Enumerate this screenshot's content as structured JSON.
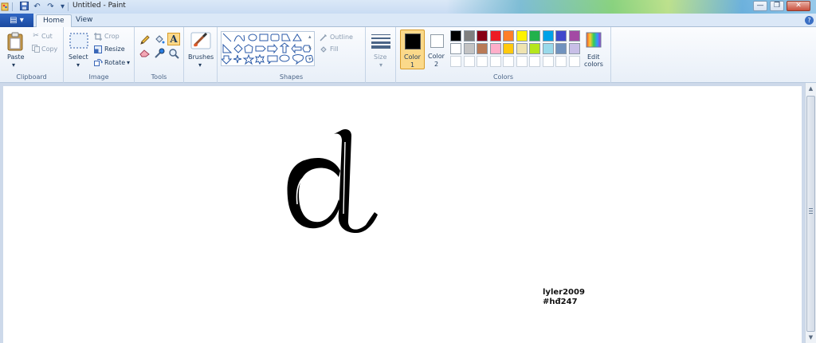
{
  "window": {
    "title": "Untitled - Paint",
    "qa_undo": "↶",
    "qa_redo": "↷",
    "qa_dropdown": "▾",
    "minimize": "—",
    "maximize": "❐",
    "close": "✕"
  },
  "tabs": {
    "file": "▤ ▾",
    "home": "Home",
    "view": "View",
    "help": "?"
  },
  "ribbon": {
    "clipboard": {
      "paste": "Paste",
      "cut": "Cut",
      "copy": "Copy",
      "label": "Clipboard"
    },
    "image": {
      "select": "Select",
      "crop": "Crop",
      "resize": "Resize",
      "rotate": "Rotate",
      "label": "Image"
    },
    "tools": {
      "label": "Tools"
    },
    "brushes": {
      "label": "Brushes"
    },
    "shapes": {
      "outline": "Outline",
      "fill": "Fill",
      "label": "Shapes"
    },
    "size": {
      "label": "Size"
    },
    "colors": {
      "color1_line1": "Color",
      "color1_line2": "1",
      "color2_line1": "Color",
      "color2_line2": "2",
      "edit_line1": "Edit",
      "edit_line2": "colors",
      "label": "Colors",
      "color1_value": "#000000",
      "color2_value": "#ffffff",
      "palette_row1": [
        "#000000",
        "#7f7f7f",
        "#880015",
        "#ed1c24",
        "#ff7f27",
        "#fff200",
        "#22b14c",
        "#00a2e8",
        "#3f48cc",
        "#a349a4"
      ],
      "palette_row2": [
        "#ffffff",
        "#c3c3c3",
        "#b97a57",
        "#ffaec9",
        "#ffc90e",
        "#efe4b0",
        "#b5e61d",
        "#99d9ea",
        "#7092be",
        "#c8bfe7"
      ]
    }
  },
  "canvas": {
    "drawn_letter": "d",
    "signature_line1": "lyler2009",
    "signature_line2": "#hđ247"
  },
  "scrollbar": {
    "up": "▲",
    "down": "▼"
  }
}
